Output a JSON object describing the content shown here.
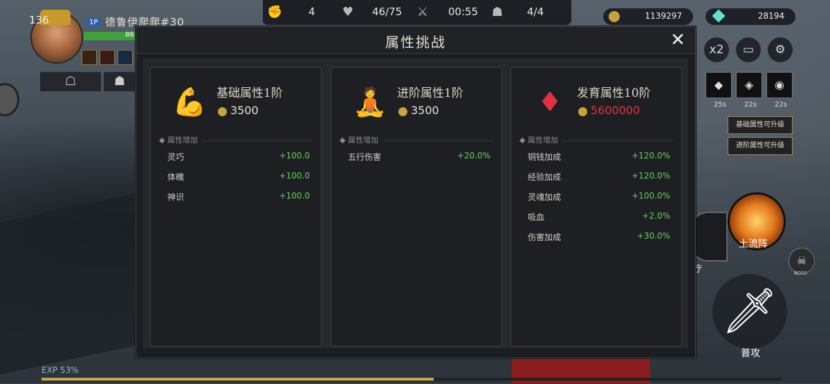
{
  "hud": {
    "level": "136",
    "badge": "1P",
    "player_name": "德鲁伊爬爬#30",
    "hp_text": "86",
    "hp_fraction": 0.75,
    "stats": {
      "fist": "4",
      "heart": "46/75",
      "timer": "00:55",
      "mask": "4/4"
    },
    "coins": "1139297",
    "gems": "28194",
    "x2_label": "x2",
    "cooldowns": [
      "25s",
      "22s",
      "22s"
    ],
    "notices": [
      "基础属性可升级",
      "进阶属性可升级"
    ],
    "skill_big_label": "土流阵",
    "skill_mid_label": "疗",
    "boss_label": "BOSS",
    "attack_label": "普攻",
    "exp_label": "EXP 53%",
    "exp_fraction": 0.53
  },
  "modal": {
    "title": "属性挑战",
    "close_icon": "close-icon",
    "cards": [
      {
        "icon": "flexed-arm-icon",
        "icon_color": "#7fe0b0",
        "title": "基础属性1阶",
        "cost": "3500",
        "cost_color": "#e6e1d4",
        "section": "属性增加",
        "rows": [
          {
            "name": "灵巧",
            "value": "+100.0"
          },
          {
            "name": "体魄",
            "value": "+100.0"
          },
          {
            "name": "神识",
            "value": "+100.0"
          }
        ]
      },
      {
        "icon": "warrior-figure-icon",
        "icon_color": "#9fd8ff",
        "title": "进阶属性1阶",
        "cost": "3500",
        "cost_color": "#e6e1d4",
        "section": "属性增加",
        "rows": [
          {
            "name": "五行伤害",
            "value": "+20.0%"
          }
        ]
      },
      {
        "icon": "red-crystal-icon",
        "icon_color": "#e0333d",
        "title": "发育属性10阶",
        "cost": "5600000",
        "cost_color": "#e0333d",
        "section": "属性增加",
        "rows": [
          {
            "name": "铜钱加成",
            "value": "+120.0%"
          },
          {
            "name": "经验加成",
            "value": "+120.0%"
          },
          {
            "name": "灵魂加成",
            "value": "+100.0%"
          },
          {
            "name": "吸血",
            "value": "+2.0%"
          },
          {
            "name": "伤害加成",
            "value": "+30.0%"
          }
        ]
      }
    ]
  }
}
